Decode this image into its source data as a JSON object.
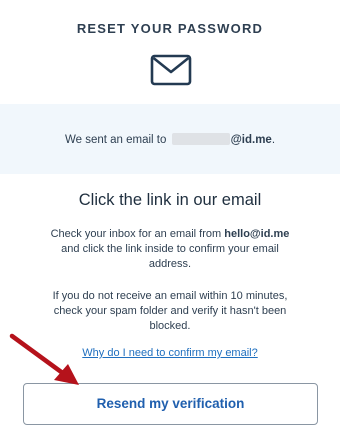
{
  "header": {
    "title": "RESET YOUR PASSWORD"
  },
  "banner": {
    "prefix": "We sent an email to ",
    "domain": "@id.me",
    "suffix": "."
  },
  "main": {
    "heading": "Click the link in our email",
    "para1": {
      "before": "Check your inbox for an email from ",
      "sender": "hello@id.me",
      "after": " and click the link inside to confirm your email address."
    },
    "para2": "If you do not receive an email within 10 minutes, check your spam folder and verify it hasn't been blocked.",
    "help_link": "Why do I need to confirm my email?",
    "resend_label": "Resend my verification"
  },
  "colors": {
    "banner_bg": "#f1f7fc",
    "link": "#1f6fbf",
    "button_text": "#1f5fae",
    "arrow": "#b5121b"
  },
  "icons": {
    "mail": "envelope-icon",
    "arrow": "red-arrow-annotation"
  }
}
